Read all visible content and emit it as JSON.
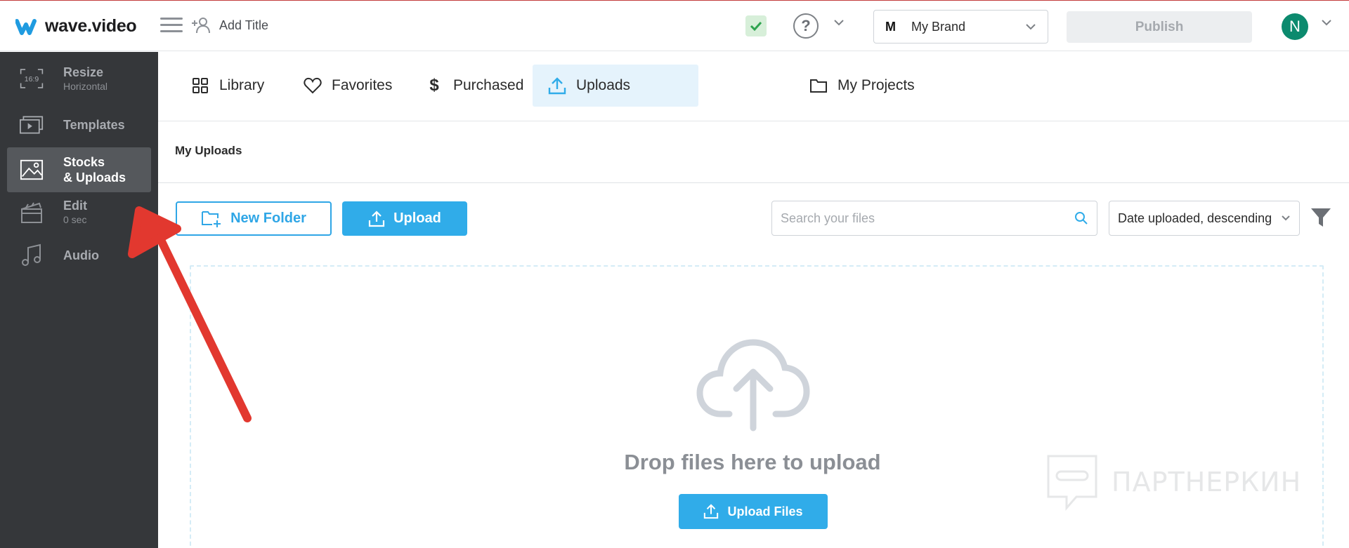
{
  "app": {
    "logo_text": "wave.video",
    "add_title_label": "Add Title",
    "brand": {
      "initial": "M",
      "name": "My Brand"
    },
    "publish_label": "Publish",
    "user_initial": "N",
    "help_symbol": "?"
  },
  "sidebar": {
    "items": [
      {
        "label": "Resize",
        "sub": "Horizontal",
        "icon_text": "16:9",
        "icon": "aspect-ratio-icon"
      },
      {
        "label": "Templates",
        "sub": "",
        "icon": "templates-icon"
      },
      {
        "label": "Stocks",
        "label2": "& Uploads",
        "icon": "image-icon",
        "active": true
      },
      {
        "label": "Edit",
        "sub": "0 sec",
        "icon": "clapperboard-icon"
      },
      {
        "label": "Audio",
        "sub": "",
        "icon": "music-note-icon"
      }
    ]
  },
  "tabs": [
    {
      "label": "Library",
      "icon": "grid-icon"
    },
    {
      "label": "Favorites",
      "icon": "heart-icon"
    },
    {
      "label": "Purchased",
      "icon": "dollar-icon"
    },
    {
      "label": "Uploads",
      "icon": "upload-icon",
      "active": true
    },
    {
      "label": "My Projects",
      "icon": "folder-icon"
    }
  ],
  "section": {
    "title": "My Uploads"
  },
  "toolbar": {
    "new_folder_label": "New Folder",
    "upload_label": "Upload",
    "search_placeholder": "Search your files",
    "sort_value": "Date uploaded, descending"
  },
  "dropzone": {
    "text": "Drop files here to upload",
    "button_label": "Upload Files"
  },
  "watermark": {
    "text": "ПАРТНЕРКИН"
  },
  "colors": {
    "accent": "#30ace9",
    "sidebar_bg": "#35373a",
    "sidebar_active": "#55585c",
    "annotation_arrow": "#e2382f",
    "avatar": "#0c8a6e"
  }
}
